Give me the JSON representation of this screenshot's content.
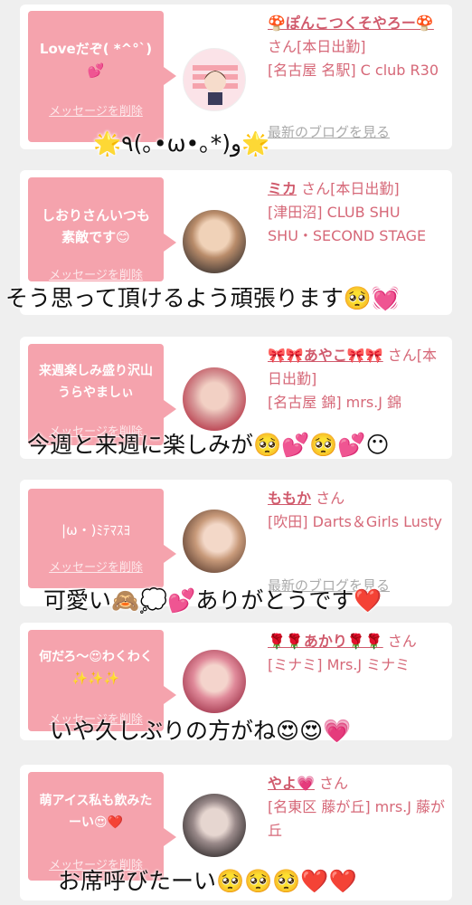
{
  "delete_label": "メッセージを削除",
  "blog_label": "最新のブログを見る",
  "colors": {
    "bubble": "#f5a3ad",
    "accent": "#d66878",
    "background": "#efefef"
  },
  "cards": [
    {
      "message": "Loveだぞ( *^°`)💕",
      "name": "🍄ぽんこつくそやろー🍄",
      "suffix": "さん[本日出勤]",
      "shop": "[名古屋 名駅] C club R30",
      "caption": "🌟٩(｡•ω•｡*)و🌟"
    },
    {
      "message": "しおりさんいつも素敵です😊",
      "name": "ミカ",
      "suffix": "さん[本日出勤]",
      "shop": "[津田沼] CLUB SHU SHU・SECOND STAGE",
      "caption": "そう思って頂けるよう頑張ります🥺💓"
    },
    {
      "message": "来週楽しみ盛り沢山うらやましぃ",
      "name": "🎀🎀あやこ🎀🎀",
      "suffix": "さん[本日出勤]",
      "shop": "[名古屋 錦] mrs.J 錦",
      "caption": "今週と来週に楽しみが🥺💕🥺💕😶"
    },
    {
      "message": "|ω・)ﾐﾃﾏｽﾖ",
      "name": "ももか",
      "suffix": "さん",
      "shop": "[吹田] Darts＆Girls Lusty",
      "caption": "可愛い🙈💭💕ありがとうです❤️"
    },
    {
      "message": "何だろ〜😍わくわく✨✨✨",
      "name": "🌹🌹あかり🌹🌹",
      "suffix": "さん",
      "shop": "[ミナミ] Mrs.J ミナミ",
      "caption": "いや久しぶりの方がね😍😍💗"
    },
    {
      "message": "萌アイス私も飲みたーい😍❤️",
      "name": "やよ💗",
      "suffix": "さん",
      "shop": "[名東区 藤が丘] mrs.J 藤が丘",
      "caption": "お席呼びたーい🥺🥺🥺❤️❤️"
    }
  ]
}
